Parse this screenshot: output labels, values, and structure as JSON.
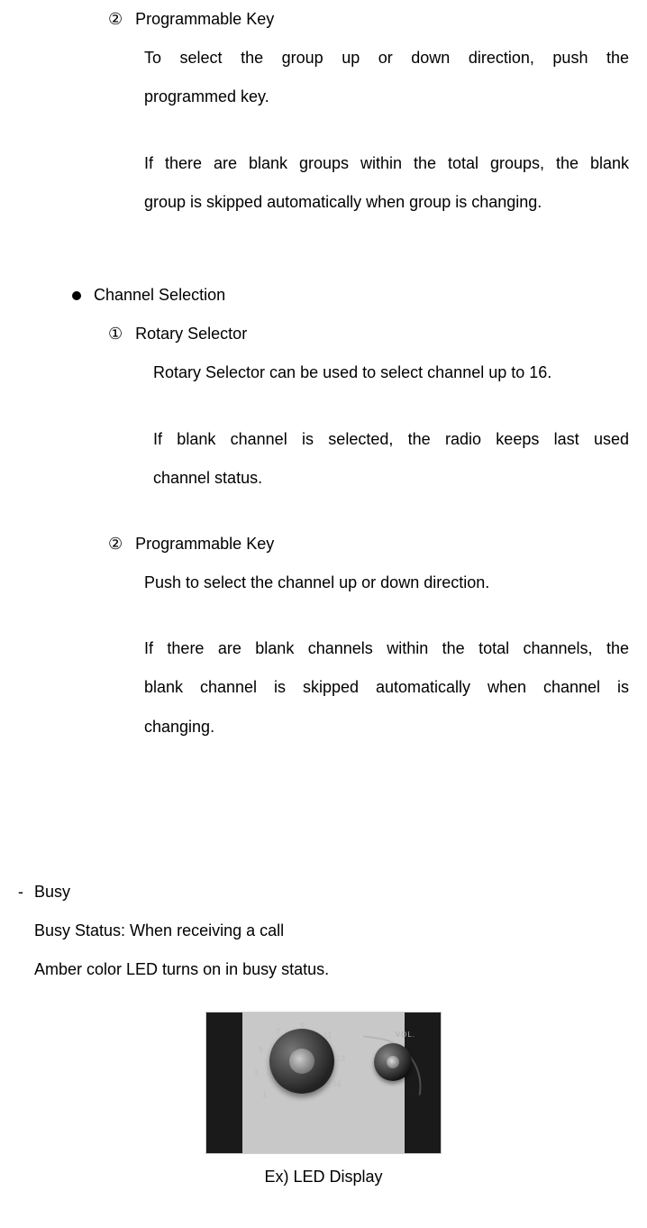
{
  "s1": {
    "num": "②",
    "title": "Programmable Key",
    "p1a": "To select the group up or down direction, push the",
    "p1b": "programmed key.",
    "p2a": "If there are blank groups within the total groups, the blank",
    "p2b": "group is skipped automatically when group is changing."
  },
  "cs": {
    "heading": "Channel Selection",
    "a": {
      "num": "①",
      "title": "Rotary Selector",
      "p1": "Rotary Selector can be used to select channel up to 16.",
      "p2a": "If blank channel is selected, the radio keeps last used",
      "p2b": "channel status."
    },
    "b": {
      "num": "②",
      "title": "Programmable Key",
      "p1": "Push to select the channel up or down direction.",
      "p2a": "If there are blank channels within the total channels, the",
      "p2b": "blank channel is skipped automatically when channel is",
      "p2c": "changing."
    }
  },
  "busy": {
    "dash": "-",
    "title": "Busy",
    "l1": "Busy Status: When receiving a call",
    "l2": "Amber color LED turns on in busy status."
  },
  "fig": {
    "caption": "Ex) LED Display",
    "vol": "VOL.",
    "ticks": [
      "1",
      "3",
      "5",
      "7",
      "9",
      "11",
      "13",
      "16"
    ]
  }
}
